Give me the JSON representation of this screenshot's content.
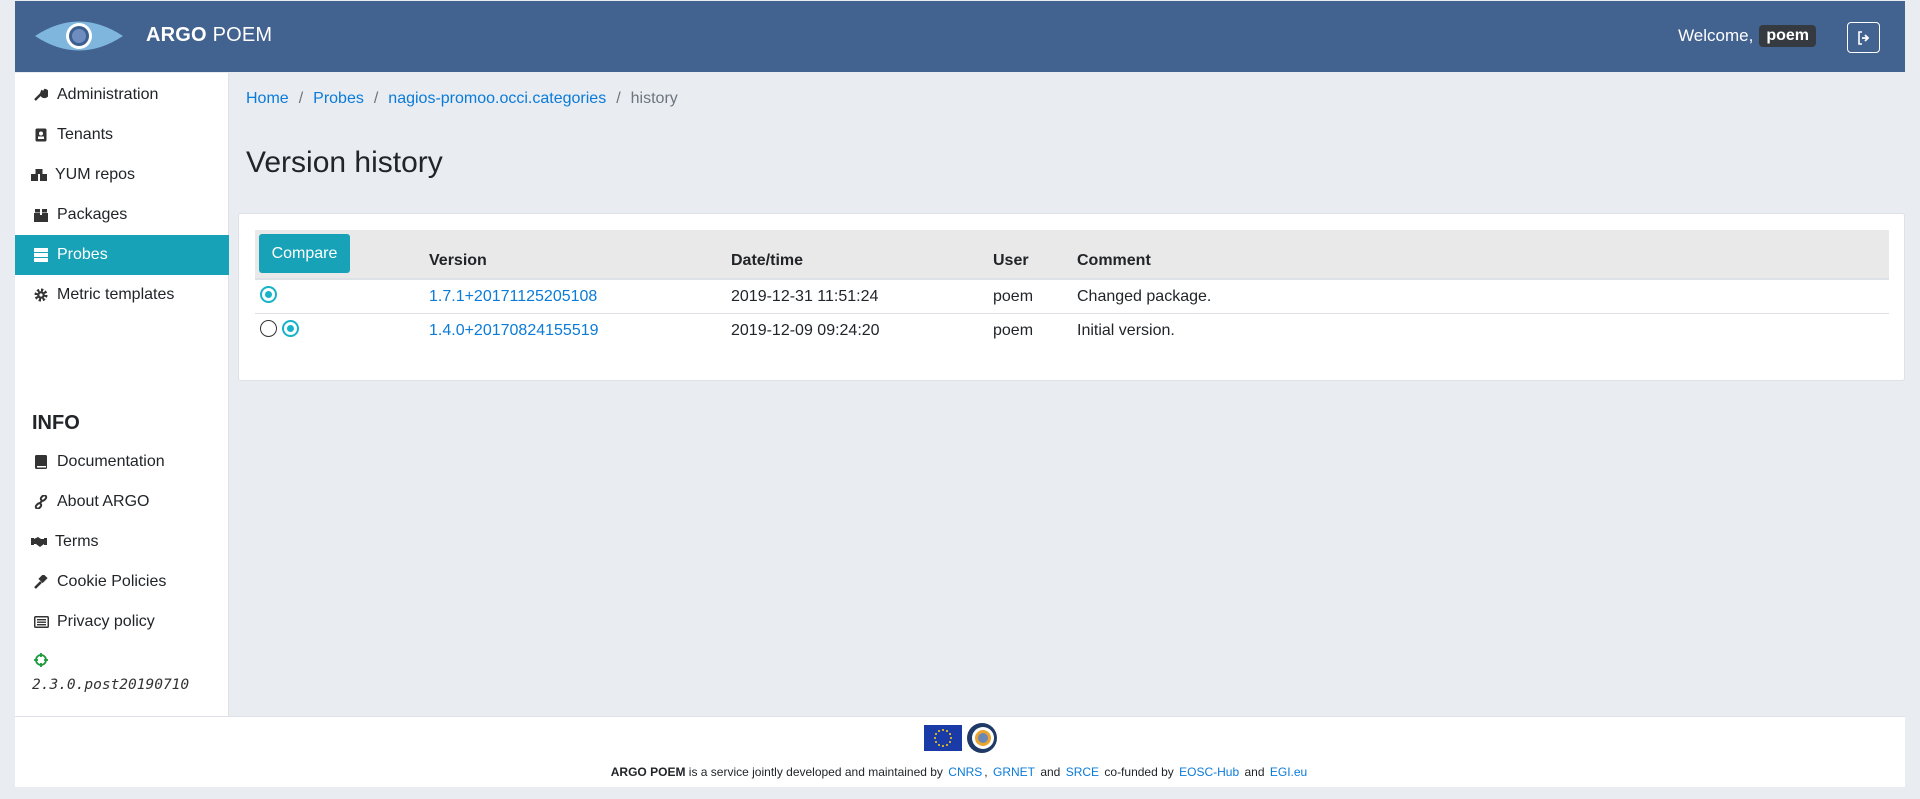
{
  "header": {
    "brand_bold": "ARGO",
    "brand_rest": "POEM",
    "welcome_label": "Welcome,",
    "username": "poem"
  },
  "sidebar": {
    "items": [
      {
        "label": "Administration",
        "icon": "wrench-icon"
      },
      {
        "label": "Tenants",
        "icon": "id-badge-icon"
      },
      {
        "label": "YUM repos",
        "icon": "boxes-icon"
      },
      {
        "label": "Packages",
        "icon": "box-icon"
      },
      {
        "label": "Probes",
        "icon": "server-icon",
        "active": true
      },
      {
        "label": "Metric templates",
        "icon": "cog-icon"
      }
    ],
    "info_title": "INFO",
    "info_items": [
      {
        "label": "Documentation",
        "icon": "book-icon"
      },
      {
        "label": "About ARGO",
        "icon": "link-icon"
      },
      {
        "label": "Terms",
        "icon": "handshake-icon"
      },
      {
        "label": "Cookie Policies",
        "icon": "gavel-icon"
      },
      {
        "label": "Privacy policy",
        "icon": "list-alt-icon"
      }
    ],
    "version": "2.3.0.post20190710"
  },
  "breadcrumb": {
    "home": "Home",
    "probes": "Probes",
    "probe_name": "nagios-promoo.occi.categories",
    "current": "history"
  },
  "main": {
    "title": "Version history",
    "compare_label": "Compare",
    "columns": {
      "version": "Version",
      "datetime": "Date/time",
      "user": "User",
      "comment": "Comment"
    },
    "rows": [
      {
        "version": "1.7.1+20171125205108",
        "datetime": "2019-12-31 11:51:24",
        "user": "poem",
        "comment": "Changed package."
      },
      {
        "version": "1.4.0+20170824155519",
        "datetime": "2019-12-09 09:24:20",
        "user": "poem",
        "comment": "Initial version."
      }
    ]
  },
  "footer": {
    "brand": "ARGO POEM",
    "text1": "is a service jointly developed and maintained by",
    "cnrs": "CNRS",
    "comma": ",",
    "grnet": "GRNET",
    "and1": "and",
    "srce": "SRCE",
    "text2": "co-funded by",
    "eosc": "EOSC-Hub",
    "and2": "and",
    "egi": "EGI.eu"
  },
  "colors": {
    "header_bg": "#42628f",
    "accent": "#17a2b8",
    "link": "#0a7bd9"
  }
}
